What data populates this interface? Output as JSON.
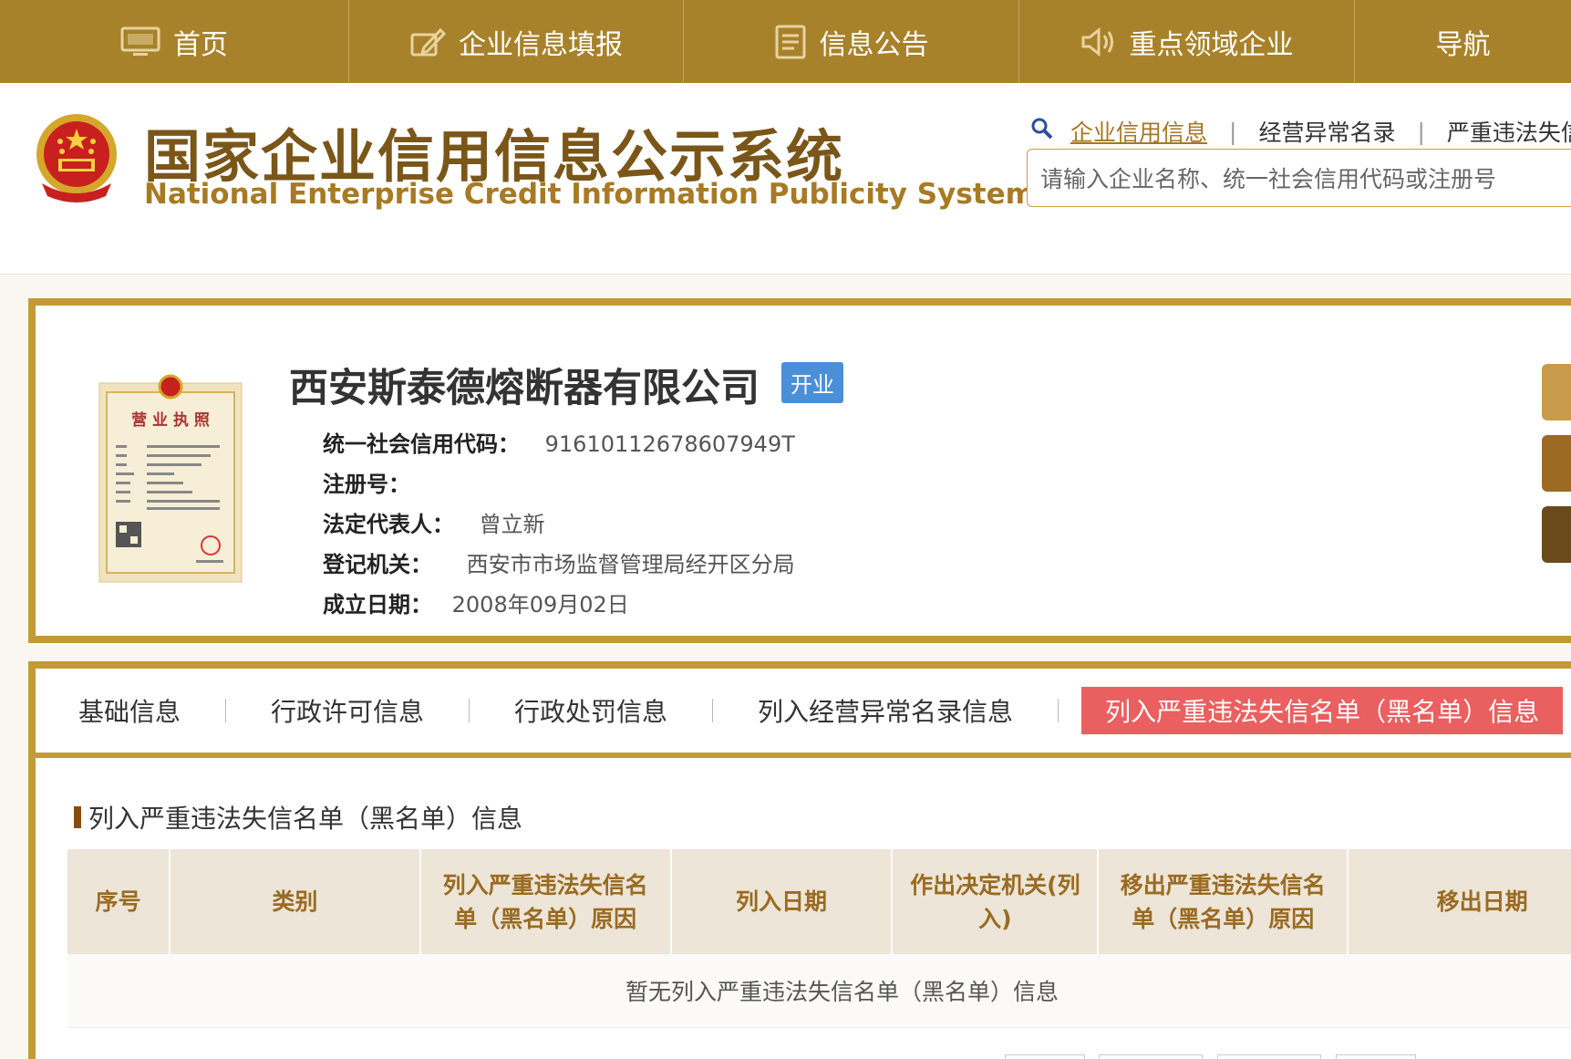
{
  "nav": {
    "items": [
      {
        "label": "首页",
        "icon": "monitor-icon"
      },
      {
        "label": "企业信息填报",
        "icon": "edit-icon"
      },
      {
        "label": "信息公告",
        "icon": "document-icon"
      },
      {
        "label": "重点领域企业",
        "icon": "speaker-icon"
      },
      {
        "label": "导航",
        "icon": ""
      }
    ]
  },
  "header": {
    "title": "国家企业信用信息公示系统",
    "subtitle": "National Enterprise Credit Information Publicity System",
    "search_tabs": [
      "企业信用信息",
      "经营异常名录",
      "严重违法失信"
    ],
    "search_placeholder": "请输入企业名称、统一社会信用代码或注册号"
  },
  "company": {
    "name": "西安斯泰德熔断器有限公司",
    "status": "开业",
    "status_color": "#4a90d9",
    "fields": [
      {
        "label": "统一社会信用代码：",
        "value": "91610112678607949T"
      },
      {
        "label": "注册号：",
        "value": ""
      },
      {
        "label": "法定代表人：",
        "value": "曾立新"
      },
      {
        "label": "登记机关：",
        "value": "西安市市场监督管理局经开区分局"
      },
      {
        "label": "成立日期：",
        "value": "2008年09月02日"
      }
    ],
    "license_title": "营 业 执 照"
  },
  "tabs": [
    "基础信息",
    "行政许可信息",
    "行政处罚信息",
    "列入经营异常名录信息",
    "列入严重违法失信名单（黑名单）信息"
  ],
  "section": {
    "title": "列入严重违法失信名单（黑名单）信息",
    "columns": [
      "序号",
      "类别",
      "列入严重违法失信名单（黑名单）原因",
      "列入日期",
      "作出决定机关(列入)",
      "移出严重违法失信名单（黑名单）原因",
      "移出日期"
    ],
    "empty_text": "暂无列入严重违法失信名单（黑名单）信息"
  },
  "colors": {
    "brand_gold": "#a8822a",
    "border_gold": "#c49a36",
    "active_tab": "#ea5f5f"
  }
}
